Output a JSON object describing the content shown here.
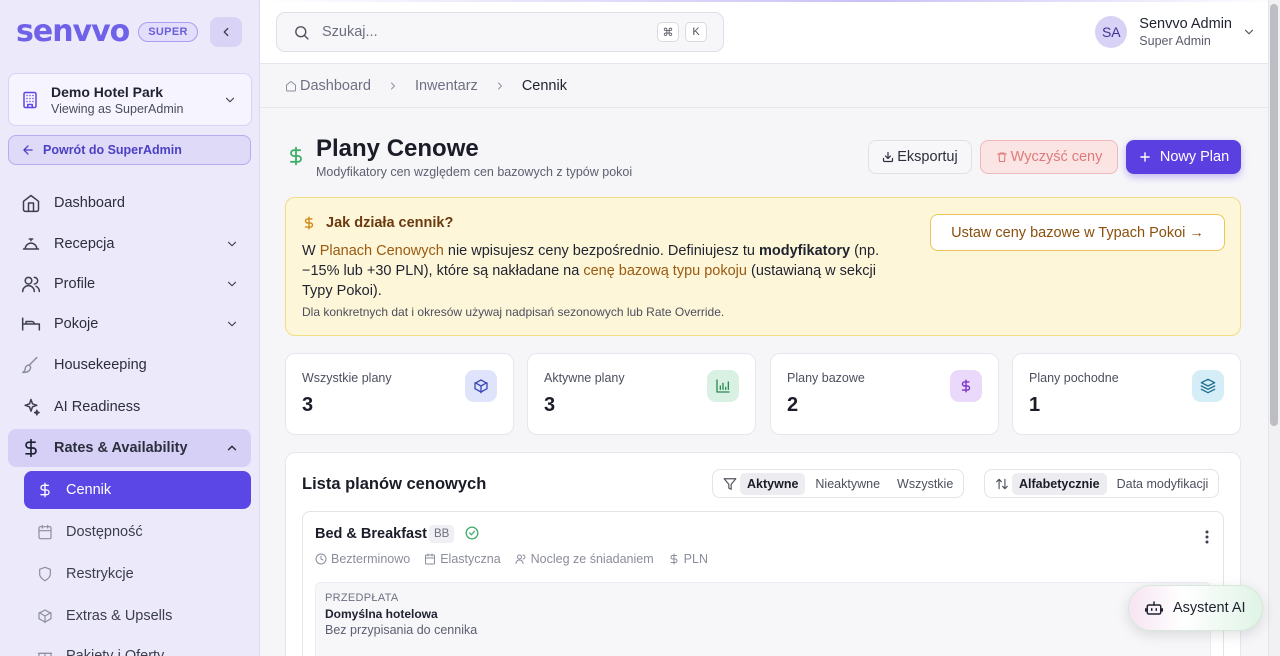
{
  "sidebar": {
    "logo": "senvvo",
    "badge": "SUPER",
    "hotel_name": "Demo Hotel Park",
    "hotel_sub": "Viewing as SuperAdmin",
    "back_label": "Powrót do SuperAdmin",
    "items": [
      {
        "label": "Dashboard",
        "icon": "home-icon"
      },
      {
        "label": "Recepcja",
        "icon": "bell-icon"
      },
      {
        "label": "Profile",
        "icon": "users-icon"
      },
      {
        "label": "Pokoje",
        "icon": "bed-icon"
      },
      {
        "label": "Housekeeping",
        "icon": "brush-icon"
      },
      {
        "label": "AI Readiness",
        "icon": "sparkles-icon"
      },
      {
        "label": "Rates & Availability",
        "icon": "dollar-icon"
      }
    ],
    "subitems": [
      {
        "label": "Cennik",
        "icon": "dollar-icon"
      },
      {
        "label": "Dostępność",
        "icon": "calendar-icon"
      },
      {
        "label": "Restrykcje",
        "icon": "shield-icon"
      },
      {
        "label": "Extras & Upsells",
        "icon": "box-icon"
      },
      {
        "label": "Pakiety i Oferty",
        "icon": "package-icon"
      }
    ]
  },
  "topbar": {
    "search_placeholder": "Szukaj...",
    "kbd1": "⌘",
    "kbd2": "K",
    "avatar": "SA",
    "user_name": "Senvvo Admin",
    "user_role": "Super Admin"
  },
  "breadcrumb": {
    "items": [
      "Dashboard",
      "Inwentarz",
      "Cennik"
    ]
  },
  "page": {
    "title": "Plany Cenowe",
    "subtitle": "Modyfikatory cen względem cen bazowych z typów pokoi",
    "export_label": "Eksportuj",
    "clear_label": "Wyczyść ceny",
    "new_label": "Nowy Plan"
  },
  "info": {
    "title": "Jak działa cennik?",
    "p1": "W ",
    "p2": "Planach Cenowych",
    "p3": " nie wpisujesz ceny bezpośrednio. Definiujesz tu ",
    "p4": "modyfikatory",
    "p5": " (np. −15% lub +30 PLN), które są nakładane na ",
    "p6": "cenę bazową typu pokoju",
    "p7": " (ustawianą w sekcji Typy Pokoi).",
    "note": "Dla konkretnych dat i okresów używaj nadpisań sezonowych lub Rate Override.",
    "button": "Ustaw ceny bazowe w Typach Pokoi →"
  },
  "stats": [
    {
      "label": "Wszystkie plany",
      "value": "3",
      "icon": "cube-icon"
    },
    {
      "label": "Aktywne plany",
      "value": "3",
      "icon": "bar-chart-icon"
    },
    {
      "label": "Plany bazowe",
      "value": "2",
      "icon": "dollar-icon"
    },
    {
      "label": "Plany pochodne",
      "value": "1",
      "icon": "layers-icon"
    }
  ],
  "list": {
    "title": "Lista planów cenowych",
    "filters": [
      "Aktywne",
      "Nieaktywne",
      "Wszystkie"
    ],
    "sorts": [
      "Alfabetycznie",
      "Data modyfikacji"
    ],
    "plan": {
      "name": "Bed & Breakfast",
      "code": "BB",
      "meta": [
        "Bezterminowo",
        "Elastyczna",
        "Nocleg ze śniadaniem",
        "PLN"
      ],
      "prepay_label": "PRZEDPŁATA",
      "prepay_value": "Domyślna hotelowa",
      "prepay_sub": "Bez przypisania do cennika"
    }
  },
  "assistant": {
    "label": "Asystent AI"
  },
  "colors": {
    "accent": "#5b3fe0",
    "sidebar_bg": "#ece9fb",
    "info_bg": "#fdf6d8"
  }
}
